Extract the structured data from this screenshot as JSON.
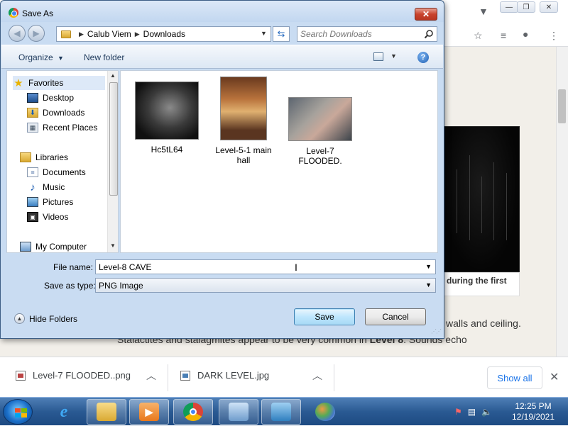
{
  "dialog": {
    "title": "Save As",
    "close_label": "✕",
    "address": {
      "segments": [
        "Calub Viem",
        "Downloads"
      ]
    },
    "search": {
      "placeholder": "Search Downloads"
    },
    "toolbar": {
      "organize_label": "Organize",
      "new_folder_label": "New folder"
    },
    "nav_tree": {
      "items": [
        {
          "label": "Favorites",
          "icon": "star-icon"
        },
        {
          "label": "Desktop",
          "icon": "desktop-icon"
        },
        {
          "label": "Downloads",
          "icon": "downloads-folder-icon"
        },
        {
          "label": "Recent Places",
          "icon": "recent-places-icon"
        },
        {
          "label": "Libraries",
          "icon": "libraries-icon"
        },
        {
          "label": "Documents",
          "icon": "documents-icon"
        },
        {
          "label": "Music",
          "icon": "music-icon"
        },
        {
          "label": "Pictures",
          "icon": "pictures-icon"
        },
        {
          "label": "Videos",
          "icon": "videos-icon"
        },
        {
          "label": "My Computer",
          "icon": "computer-icon"
        }
      ]
    },
    "files": [
      {
        "name": "Hc5tL64"
      },
      {
        "name": "Level-5-1 main hall"
      },
      {
        "name": "Level-7 FLOODED."
      }
    ],
    "form": {
      "filename_label": "File name:",
      "filename_value": "Level-8 CAVE",
      "type_label": "Save as type:",
      "type_value": "PNG Image",
      "hide_folders_label": "Hide Folders",
      "save_label": "Save",
      "cancel_label": "Cancel"
    }
  },
  "page": {
    "caption_text": "during the first",
    "text_line1": "walls and ceiling.",
    "text_line2_prefix": "Stalactites and stalagmites appear to be very common in ",
    "text_line2_bold": "Level 8",
    "text_line2_suffix": ". Sounds echo"
  },
  "downloads": {
    "items": [
      {
        "name": "Level-7 FLOODED..png",
        "icon": "png-file-icon"
      },
      {
        "name": "DARK LEVEL.jpg",
        "icon": "jpg-file-icon"
      }
    ],
    "show_all_label": "Show all"
  },
  "taskbar": {
    "time": "12:25 PM",
    "date": "12/19/2021"
  }
}
